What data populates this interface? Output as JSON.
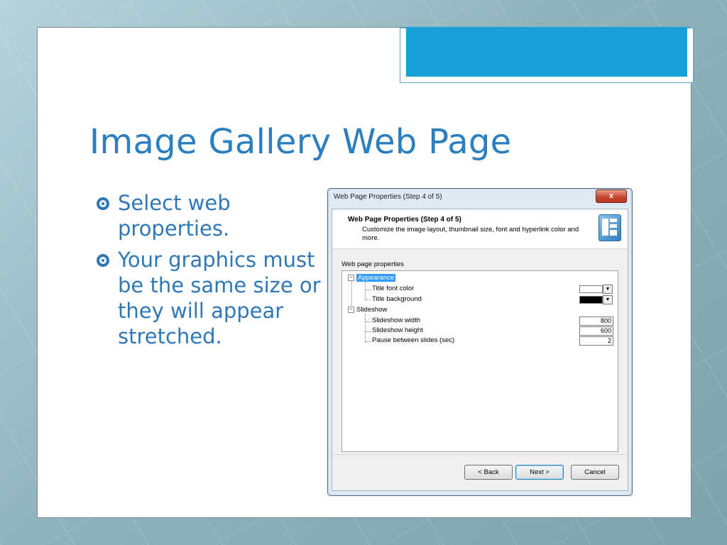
{
  "slide": {
    "title": "Image Gallery Web Page",
    "bullets": [
      "Select web properties.",
      "Your graphics must be the same size or they will appear stretched."
    ]
  },
  "dialog": {
    "window_title": "Web Page Properties (Step 4 of 5)",
    "close_label": "x",
    "header_title": "Web Page Properties (Step 4 of 5)",
    "header_description": "Customize the image layout, thumbnail size, font and hyperlink color and more.",
    "section_label": "Web page properties",
    "tree": {
      "appearance": {
        "label": "Appearance",
        "expander": "−",
        "title_font_color": {
          "label": "Title font color",
          "color": "#ffffff"
        },
        "title_background": {
          "label": "Title background",
          "color": "#000000"
        }
      },
      "slideshow": {
        "label": "Slideshow",
        "expander": "−",
        "width": {
          "label": "Slideshow width",
          "value": "800"
        },
        "height": {
          "label": "Slideshow height",
          "value": "600"
        },
        "pause": {
          "label": "Pause between slides (sec)",
          "value": "2"
        }
      }
    },
    "buttons": {
      "back": "< Back",
      "next": "Next >",
      "cancel": "Cancel"
    }
  }
}
